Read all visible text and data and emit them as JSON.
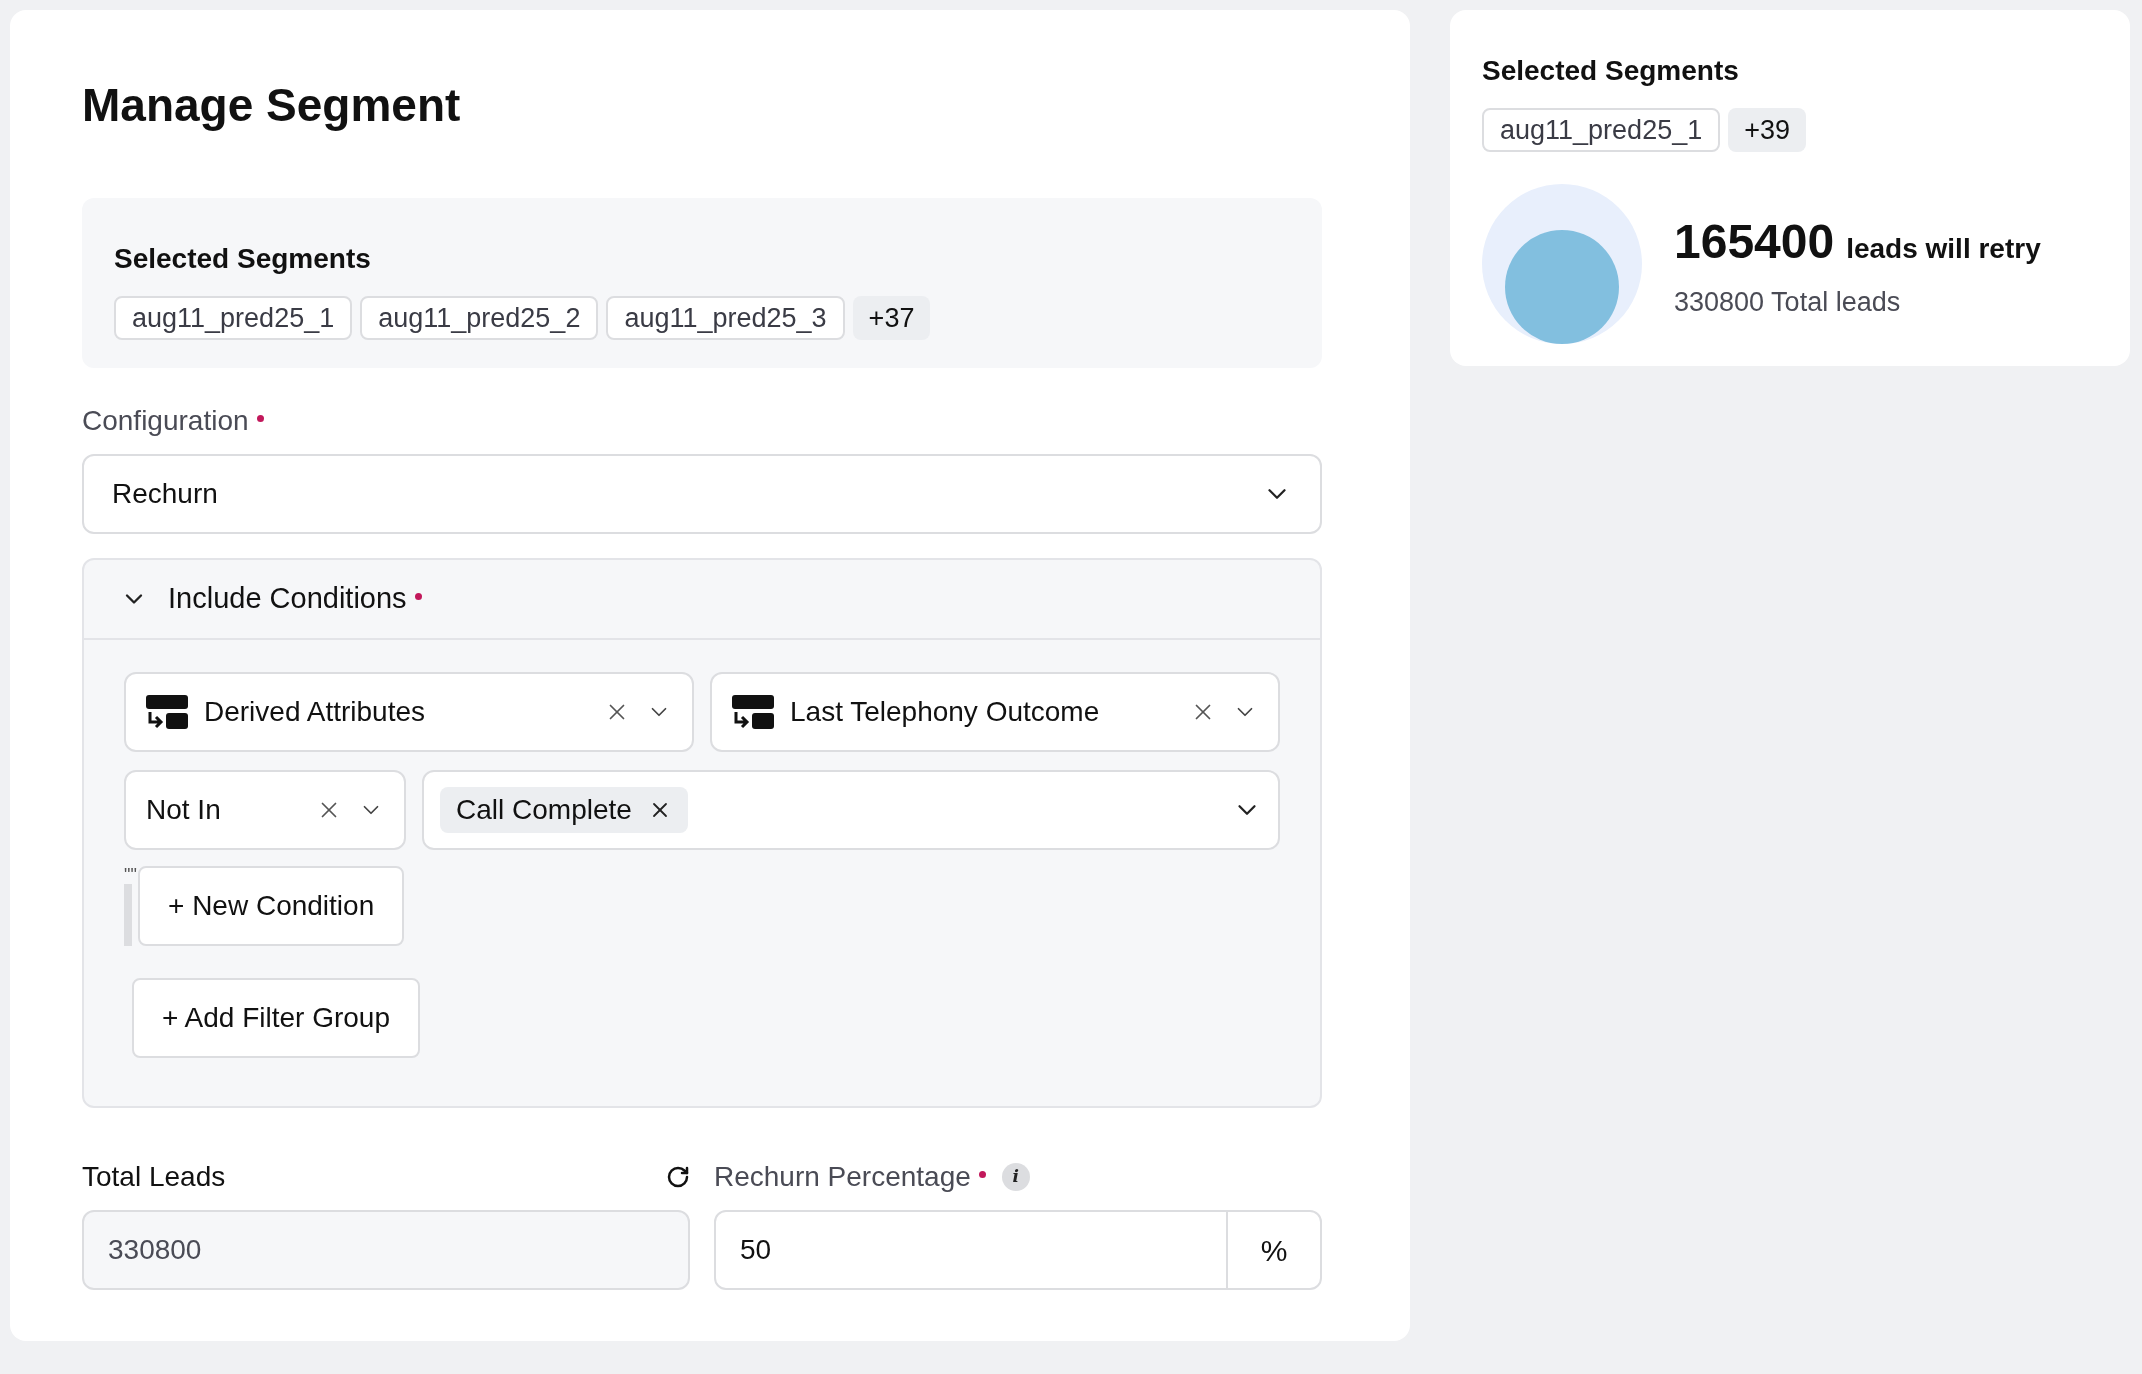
{
  "title": "Manage Segment",
  "selected_segments": {
    "heading": "Selected Segments",
    "tags": [
      "aug11_pred25_1",
      "aug11_pred25_2",
      "aug11_pred25_3"
    ],
    "more": "+37"
  },
  "configuration": {
    "label": "Configuration",
    "required": true,
    "value": "Rechurn"
  },
  "include_conditions": {
    "title": "Include Conditions",
    "required": true,
    "expanded": true,
    "conditions": [
      {
        "attribute_group": "Derived Attributes",
        "attribute": "Last Telephony Outcome",
        "operator": "Not In",
        "values": [
          "Call Complete"
        ]
      }
    ],
    "group_marker": "\"\"",
    "new_condition": "+ New Condition",
    "add_filter_group": "+ Add Filter Group"
  },
  "total_leads": {
    "label": "Total Leads",
    "value": "330800"
  },
  "rechurn_percentage": {
    "label": "Rechurn Percentage",
    "required": true,
    "value": "50",
    "unit": "%",
    "info_mark": "i"
  },
  "summary": {
    "heading": "Selected Segments",
    "tags": [
      "aug11_pred25_1"
    ],
    "more": "+39",
    "retry_count": "165400",
    "retry_text": "leads will retry",
    "total_text": "330800 Total leads"
  }
}
